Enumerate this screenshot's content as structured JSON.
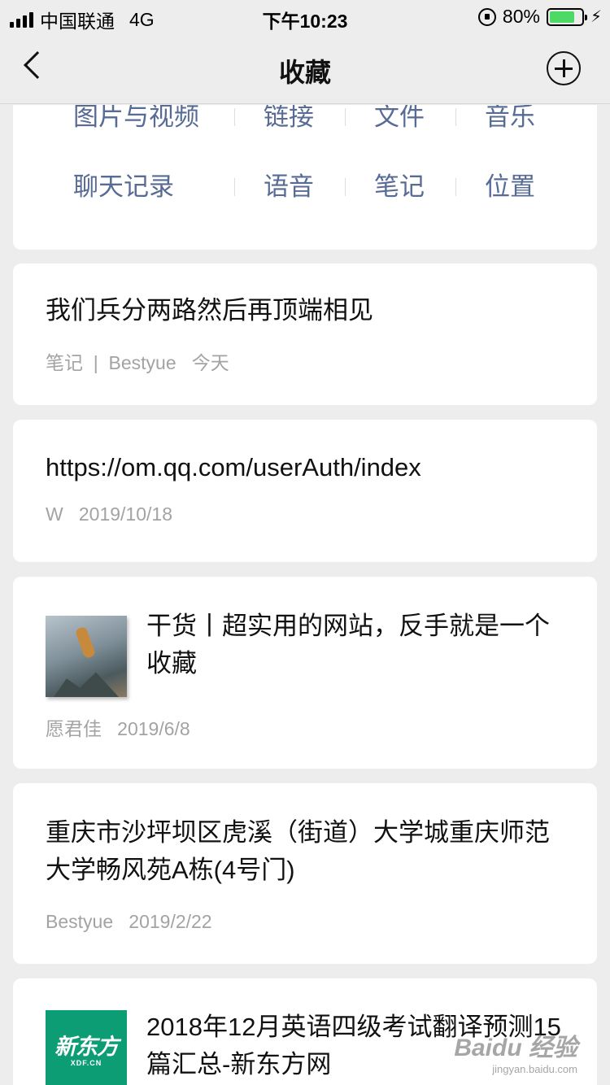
{
  "status_bar": {
    "carrier": "中国联通",
    "network": "4G",
    "time": "下午10:23",
    "battery": "80%",
    "battery_level": 0.8
  },
  "nav": {
    "title": "收藏",
    "back_icon": "chevron-left-icon",
    "add_icon": "plus-circle-icon"
  },
  "categories": {
    "row1": [
      "图片与视频",
      "链接",
      "文件",
      "音乐"
    ],
    "row2": [
      "聊天记录",
      "语音",
      "笔记",
      "位置"
    ]
  },
  "items": [
    {
      "title": "我们兵分两路然后再顶端相见",
      "meta": "笔记  |  Bestyue   今天"
    },
    {
      "title": "https://om.qq.com/userAuth/index",
      "meta": "W   2019/10/18"
    },
    {
      "title": "干货丨超实用的网站，反手就是一个收藏",
      "meta": "愿君佳   2019/6/8",
      "thumbnail": "photo"
    },
    {
      "title": "重庆市沙坪坝区虎溪（街道）大学城重庆师范大学畅风苑A栋(4号门)",
      "meta": "Bestyue   2019/2/22"
    },
    {
      "title": "2018年12月英语四级考试翻译预测15篇汇总-新东方网",
      "thumbnail": "logo",
      "logo_text": "新东方",
      "logo_sub": "XDF.CN"
    }
  ],
  "watermark": {
    "main": "Baidu 经验",
    "sub": "jingyan.baidu.com"
  }
}
